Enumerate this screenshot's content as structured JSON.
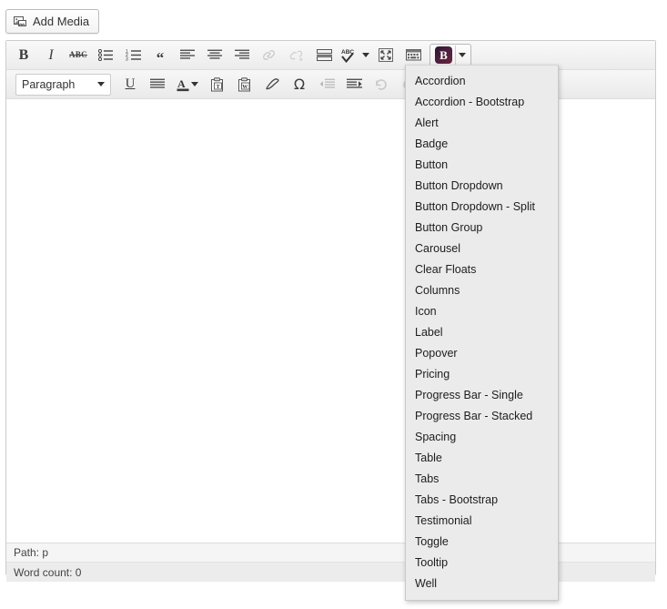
{
  "media": {
    "add_media_label": "Add Media",
    "icon": "add-media-icon"
  },
  "toolbar_row1": [
    {
      "name": "bold-button",
      "icon": "bold-icon",
      "label": "B",
      "disabled": false
    },
    {
      "name": "italic-button",
      "icon": "italic-icon",
      "label": "I",
      "disabled": false
    },
    {
      "name": "strikethrough-button",
      "icon": "strikethrough-icon",
      "label": "ABC",
      "disabled": false
    },
    {
      "name": "bullet-list-button",
      "icon": "unordered-list-icon",
      "label": "",
      "disabled": false
    },
    {
      "name": "numbered-list-button",
      "icon": "ordered-list-icon",
      "label": "",
      "disabled": false
    },
    {
      "name": "blockquote-button",
      "icon": "blockquote-icon",
      "label": "",
      "disabled": false
    },
    {
      "name": "align-left-button",
      "icon": "align-left-icon",
      "label": "",
      "disabled": false
    },
    {
      "name": "align-center-button",
      "icon": "align-center-icon",
      "label": "",
      "disabled": false
    },
    {
      "name": "align-right-button",
      "icon": "align-right-icon",
      "label": "",
      "disabled": false
    },
    {
      "name": "insert-link-button",
      "icon": "link-icon",
      "label": "",
      "disabled": true
    },
    {
      "name": "unlink-button",
      "icon": "unlink-icon",
      "label": "",
      "disabled": true
    },
    {
      "name": "read-more-button",
      "icon": "read-more-icon",
      "label": "",
      "disabled": false
    },
    {
      "name": "spellcheck-button",
      "icon": "spellcheck-icon",
      "label": "ABC",
      "disabled": false
    },
    {
      "name": "fullscreen-button",
      "icon": "fullscreen-icon",
      "label": "",
      "disabled": false
    },
    {
      "name": "kitchen-sink-button",
      "icon": "kitchen-sink-icon",
      "label": "",
      "disabled": false
    }
  ],
  "bootstrap_button": {
    "name": "bootstrap-shortcodes-button",
    "logo_letter": "B",
    "accent_color": "#4a1f3d",
    "expanded": true
  },
  "toolbar_row2": {
    "format_select": {
      "name": "format-select",
      "value": "Paragraph"
    },
    "buttons": [
      {
        "name": "underline-button",
        "icon": "underline-icon",
        "label": "U",
        "disabled": false
      },
      {
        "name": "justify-button",
        "icon": "align-justify-icon",
        "label": "",
        "disabled": false
      },
      {
        "name": "text-color-button",
        "icon": "text-color-icon",
        "label": "A",
        "disabled": false
      },
      {
        "name": "paste-as-text-button",
        "icon": "paste-as-text-icon",
        "label": "",
        "disabled": false
      },
      {
        "name": "paste-from-word-button",
        "icon": "paste-from-word-icon",
        "label": "",
        "disabled": false
      },
      {
        "name": "remove-formatting-button",
        "icon": "eraser-icon",
        "label": "",
        "disabled": false
      },
      {
        "name": "special-character-button",
        "icon": "omega-icon",
        "label": "Ω",
        "disabled": false
      },
      {
        "name": "outdent-button",
        "icon": "outdent-icon",
        "label": "",
        "disabled": true
      },
      {
        "name": "indent-button",
        "icon": "indent-icon",
        "label": "",
        "disabled": false
      },
      {
        "name": "undo-button",
        "icon": "undo-icon",
        "label": "",
        "disabled": true
      },
      {
        "name": "redo-button",
        "icon": "redo-icon",
        "label": "",
        "disabled": true
      },
      {
        "name": "help-button",
        "icon": "help-icon",
        "label": "",
        "disabled": false
      }
    ]
  },
  "content": {
    "body_text": ""
  },
  "statusbar": {
    "path_label": "Path: p",
    "word_count_label": "Word count: 0"
  },
  "shortcode_menu": {
    "name": "bootstrap-shortcode-menu",
    "items": [
      "Accordion",
      "Accordion - Bootstrap",
      "Alert",
      "Badge",
      "Button",
      "Button Dropdown",
      "Button Dropdown - Split",
      "Button Group",
      "Carousel",
      "Clear Floats",
      "Columns",
      "Icon",
      "Label",
      "Popover",
      "Pricing",
      "Progress Bar - Single",
      "Progress Bar - Stacked",
      "Spacing",
      "Table",
      "Tabs",
      "Tabs - Bootstrap",
      "Testimonial",
      "Toggle",
      "Tooltip",
      "Well"
    ]
  }
}
